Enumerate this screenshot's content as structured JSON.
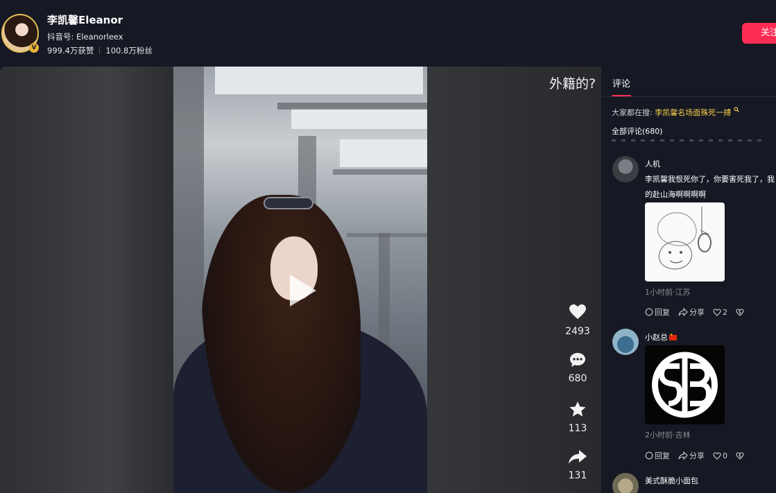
{
  "author": {
    "name": "李凯馨Eleanor",
    "douyin_id": "抖音号: Eleanorleex",
    "likes": "999.4万获赞",
    "fans": "100.8万粉丝",
    "badge": "V",
    "follow_label": "关注"
  },
  "video": {
    "overlay_title": "外籍的?",
    "play_icon": "play-icon"
  },
  "actions": {
    "like_count": "2493",
    "comment_count": "680",
    "favorite_count": "113",
    "share_count": "131"
  },
  "comments_panel": {
    "tab_label": "评论",
    "search_prefix": "大家都在搜:",
    "search_keyword": "李凯馨名场面殊死一搏",
    "all_count_label": "全部评论(680)",
    "comments": [
      {
        "user": "人机",
        "text": "李凯馨我恨死你了，你要害死我了，我的赴山海啊啊啊啊",
        "has_image": true,
        "meta": "1小时前·江苏",
        "reply_label": "回复",
        "share_label": "分享",
        "like_count": "2"
      },
      {
        "user": "小赵总",
        "has_flag": true,
        "text": "",
        "has_image": true,
        "image_text": "SB",
        "meta": "2小时前·吉林",
        "reply_label": "回复",
        "share_label": "分享",
        "like_count": "0"
      },
      {
        "user": "美式酥脆小面包"
      }
    ]
  },
  "colors": {
    "accent": "#fe2c55",
    "background": "#161823",
    "highlight": "#f5cc4b"
  }
}
